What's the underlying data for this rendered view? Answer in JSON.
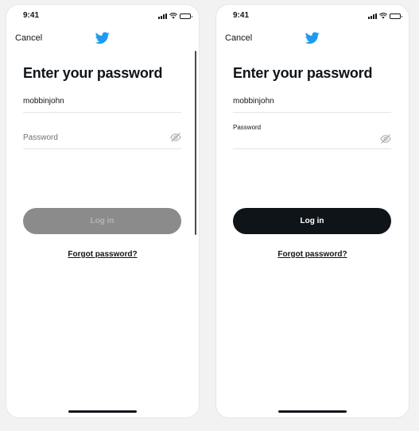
{
  "colors": {
    "brand_blue": "#1d9bf0",
    "ink": "#0f1419",
    "disabled_button": "#8b8b8b",
    "disabled_button_text": "#b4b4b4"
  },
  "screens": [
    {
      "status_time": "9:41",
      "cancel_label": "Cancel",
      "logo_icon": "twitter-bird-icon",
      "title": "Enter your password",
      "username_value": "mobbinjohn",
      "password_placeholder": "Password",
      "visibility_icon": "eye-off-icon",
      "login_label": "Log in",
      "login_state": "disabled",
      "forgot_label": "Forgot password?"
    },
    {
      "status_time": "9:41",
      "cancel_label": "Cancel",
      "logo_icon": "twitter-bird-icon",
      "title": "Enter your password",
      "username_value": "mobbinjohn",
      "password_label": "Password",
      "visibility_icon": "eye-off-icon",
      "login_label": "Log in",
      "login_state": "enabled",
      "forgot_label": "Forgot password?"
    }
  ]
}
